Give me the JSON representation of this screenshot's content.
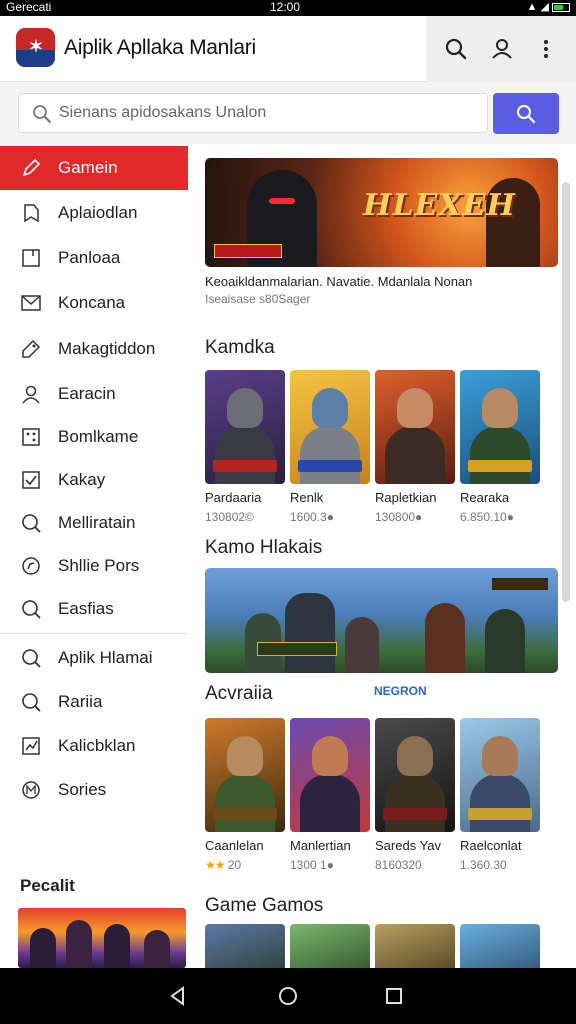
{
  "status": {
    "carrier": "Gerecati",
    "time": "12:00"
  },
  "app": {
    "title": "Aiplik Apllaka Manlari"
  },
  "search": {
    "placeholder": "Sienans apidosakans Unalon"
  },
  "sidebar": {
    "items": [
      {
        "label": "Gamein",
        "icon": "pencil-icon",
        "active": true
      },
      {
        "label": "Aplaiodlan",
        "icon": "bookmark-icon",
        "active": false
      },
      {
        "label": "Panloaa",
        "icon": "note-icon",
        "active": false
      },
      {
        "label": "Koncana",
        "icon": "mail-icon",
        "active": false
      },
      {
        "label": "Makagtiddon",
        "icon": "tag-icon",
        "active": false
      },
      {
        "label": "Earacin",
        "icon": "user-icon",
        "active": false
      },
      {
        "label": "Bomlkame",
        "icon": "dice-icon",
        "active": false
      },
      {
        "label": "Kakay",
        "icon": "checkbox-icon",
        "active": false
      },
      {
        "label": "Melliratain",
        "icon": "search-icon",
        "active": false
      },
      {
        "label": "Shllie Pors",
        "icon": "compass-icon",
        "active": false
      },
      {
        "label": "Easfias",
        "icon": "search-icon",
        "active": false
      },
      {
        "label": "Aplik Hlamai",
        "icon": "search-icon",
        "active": false
      },
      {
        "label": "Rariia",
        "icon": "search-icon",
        "active": false
      },
      {
        "label": "Kalicbklan",
        "icon": "chart-icon",
        "active": false
      },
      {
        "label": "Sories",
        "icon": "badge-icon",
        "active": false
      }
    ],
    "popular_title": "Pecalit"
  },
  "featured": {
    "banner_title": "HLEXEH",
    "description": "Keoaikldanmalarian. Navatie. Mdanlala Nonan",
    "subline": "Iseaisase s80Sager"
  },
  "sections": [
    {
      "title": "Kamdka",
      "cards": [
        {
          "name": "Pardaaria",
          "stat": "130802©",
          "palette": "purple"
        },
        {
          "name": "Renlk",
          "stat": "1600.3●",
          "palette": "gold"
        },
        {
          "name": "Rapletkian",
          "stat": "130800●",
          "palette": "red"
        },
        {
          "name": "Rearaka",
          "stat": "6.850.10●",
          "palette": "blue"
        }
      ]
    },
    {
      "title": "Kamo Hlakais",
      "banner": true
    },
    {
      "title": "Acvraiia",
      "link": "NEGRON",
      "cards": [
        {
          "name": "Caanlelan",
          "stat": "20",
          "stars": "★★",
          "palette": "green"
        },
        {
          "name": "Manlertian",
          "stat": "1300 1●",
          "palette": "purple"
        },
        {
          "name": "Sareds Yav",
          "stat": "8160320",
          "palette": "dark"
        },
        {
          "name": "Raelconlat",
          "stat": "1.360.30",
          "palette": "sky"
        }
      ]
    },
    {
      "title": "Game Gamos"
    }
  ],
  "colors": {
    "accent": "#e12a2a",
    "search_button": "#5b5ee0",
    "link": "#2b66d6"
  }
}
